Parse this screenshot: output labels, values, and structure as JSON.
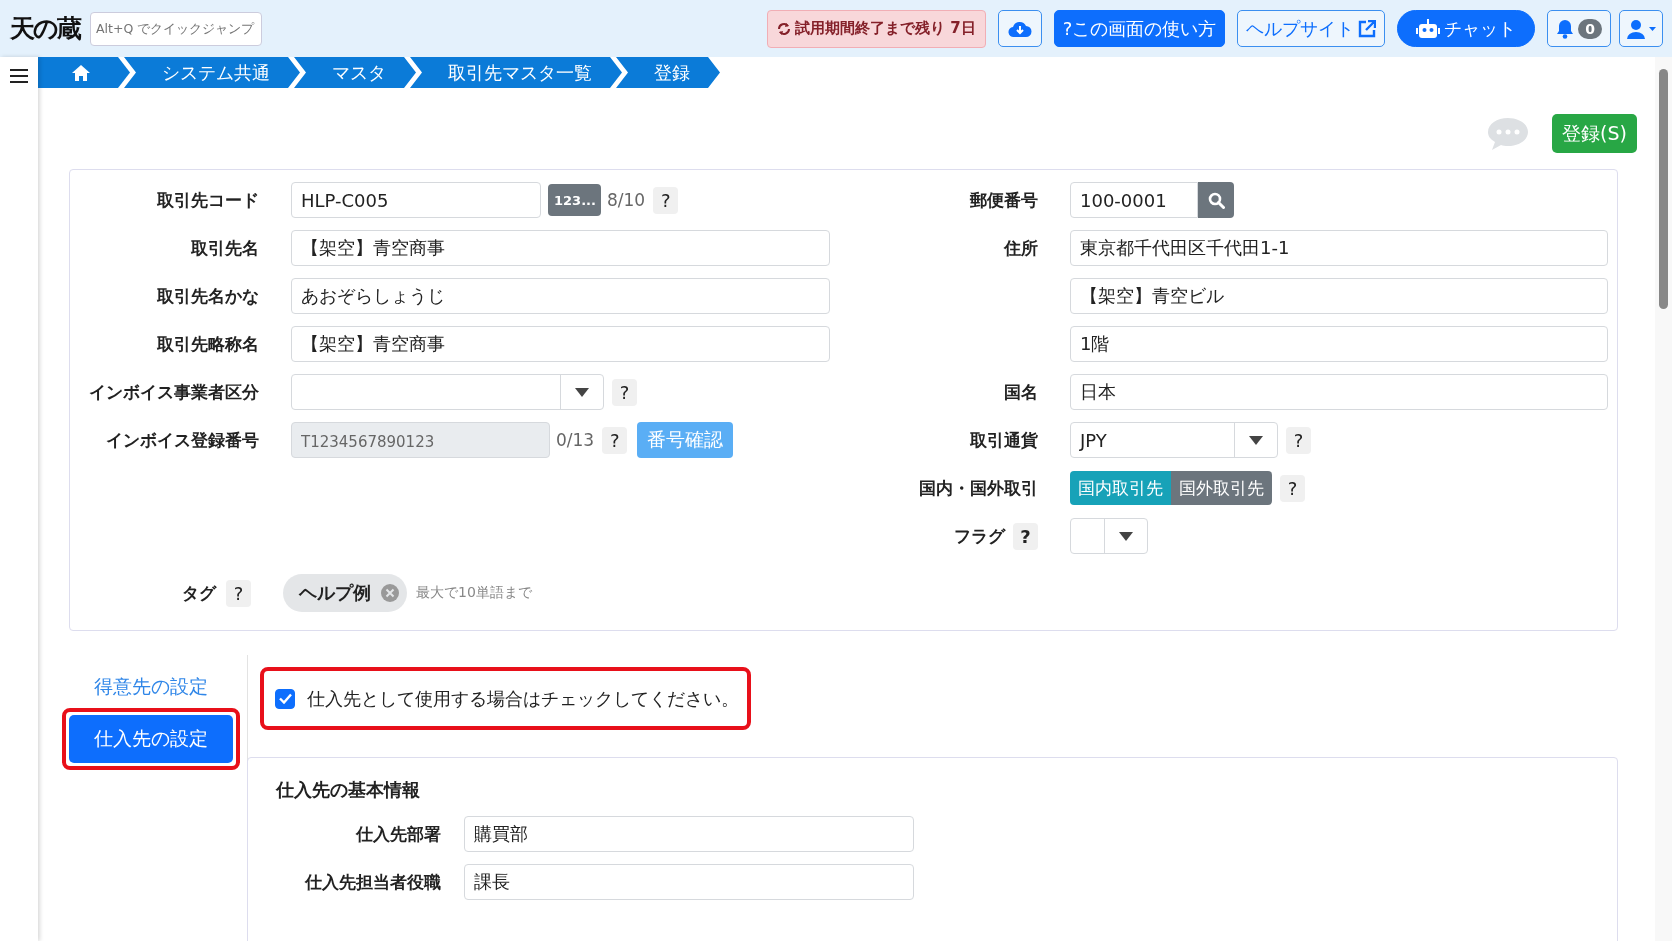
{
  "header": {
    "logo": "天の蔵",
    "quick_jump": {
      "placeholder": "Alt+Q でクイックジャンプ"
    },
    "trial_notice": "試用期間終了まで残り 7日",
    "help_button": "?この画面の使い方",
    "help_site": "ヘルプサイト",
    "chat_button": "チャット",
    "notifications": "0"
  },
  "breadcrumbs": [
    {
      "kind": "home"
    },
    {
      "kind": "text",
      "label": "システム共通"
    },
    {
      "kind": "text",
      "label": "マスタ"
    },
    {
      "kind": "text",
      "label": "取引先マスタ一覧"
    },
    {
      "kind": "text",
      "label": "登録"
    }
  ],
  "register_button": "登録(S)",
  "left_fields": [
    {
      "kind": "code",
      "label": "取引先コード",
      "value": "HLP-C005",
      "generate_button": "123...",
      "counter": "8/10",
      "help": "?"
    },
    {
      "kind": "text",
      "label": "取引先名",
      "value": "【架空】青空商事"
    },
    {
      "kind": "text",
      "label": "取引先名かな",
      "value": "あおぞらしょうじ"
    },
    {
      "kind": "text",
      "label": "取引先略称名",
      "value": "【架空】青空商事"
    },
    {
      "kind": "select",
      "label": "インボイス事業者区分",
      "help": "?"
    },
    {
      "kind": "invoice",
      "label": "インボイス登録番号",
      "placeholder": "T1234567890123",
      "counter": "0/13",
      "help": "?",
      "button": "番号確認",
      "disabled": true
    }
  ],
  "right_fields": [
    {
      "kind": "postal",
      "label": "郵便番号",
      "value": "100-0001"
    },
    {
      "kind": "text",
      "label": "住所",
      "value": "東京都千代田区千代田1-1"
    },
    {
      "kind": "text",
      "value": "【架空】青空ビル"
    },
    {
      "kind": "text",
      "value": "1階"
    },
    {
      "kind": "text",
      "label": "国名",
      "value": "日本"
    },
    {
      "kind": "select",
      "label": "取引通貨",
      "value": "JPY",
      "help": "?"
    },
    {
      "kind": "toggle",
      "label": "国内・国外取引",
      "help": "?",
      "options": [
        {
          "label": "国内取引先",
          "selected": true
        },
        {
          "label": "国外取引先",
          "selected": false
        }
      ]
    },
    {
      "kind": "flag",
      "label": "フラグ",
      "help": "?"
    }
  ],
  "tags": {
    "label": "タグ",
    "help": "?",
    "items": [
      "ヘルプ例"
    ],
    "hint": "最大で10単語まで"
  },
  "side_tabs": [
    {
      "label": "得意先の設定",
      "selected": false,
      "highlighted": false
    },
    {
      "label": "仕入先の設定",
      "selected": true,
      "highlighted": true
    }
  ],
  "supplier_checkbox": {
    "label": "仕入先として使用する場合はチェックしてください。",
    "checked": true,
    "highlighted": true
  },
  "supplier_basic": {
    "title": "仕入先の基本情報",
    "fields": [
      {
        "label": "仕入先部署",
        "value": "購買部"
      },
      {
        "label": "仕入先担当者役職",
        "value": "課長"
      }
    ]
  }
}
